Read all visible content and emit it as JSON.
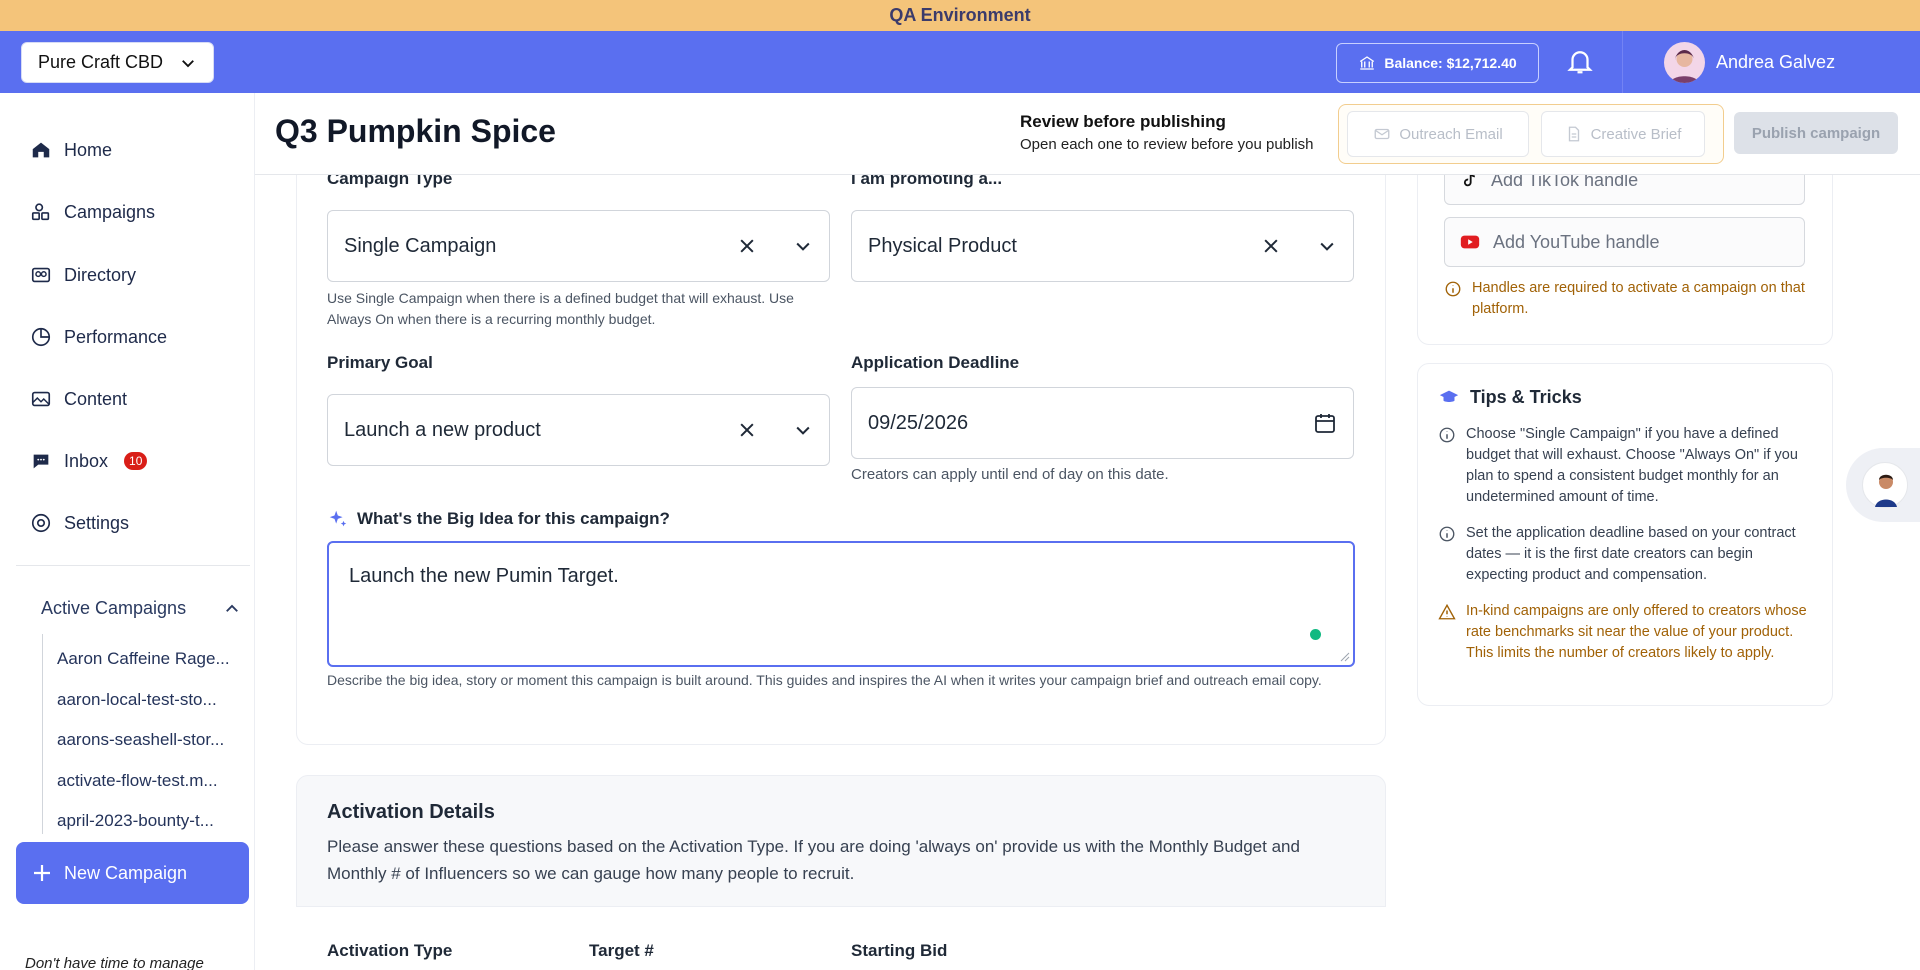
{
  "env_banner": "QA Environment",
  "topbar": {
    "org_select": "Pure Craft CBD",
    "balance": "Balance: $12,712.40",
    "user_name": "Andrea Galvez"
  },
  "sidebar": {
    "items": [
      {
        "label": "Home",
        "icon": "home-icon"
      },
      {
        "label": "Campaigns",
        "icon": "campaigns-icon"
      },
      {
        "label": "Directory",
        "icon": "directory-icon"
      },
      {
        "label": "Performance",
        "icon": "performance-icon"
      },
      {
        "label": "Content",
        "icon": "content-icon"
      },
      {
        "label": "Inbox",
        "icon": "inbox-icon",
        "badge": "10"
      },
      {
        "label": "Settings",
        "icon": "settings-icon"
      }
    ],
    "active_campaigns_label": "Active Campaigns",
    "campaigns": [
      "Aaron Caffeine Rage...",
      "aaron-local-test-sto...",
      "aarons-seashell-stor...",
      "activate-flow-test.m...",
      "april-2023-bounty-t..."
    ],
    "new_campaign": "New Campaign",
    "footer_text": "Don't have time to manage"
  },
  "header": {
    "title": "Q3 Pumpkin Spice",
    "review_title": "Review before publishing",
    "review_subtitle": "Open each one to review before you publish",
    "outreach_email": "Outreach Email",
    "creative_brief": "Creative Brief",
    "publish": "Publish campaign"
  },
  "form": {
    "campaign_type_label": "Campaign Type",
    "campaign_type_value": "Single Campaign",
    "campaign_type_help": "Use Single Campaign when there is a defined budget that will exhaust. Use Always On when there is a recurring monthly budget.",
    "promoting_label": "I am promoting a...",
    "promoting_value": "Physical Product",
    "primary_goal_label": "Primary Goal",
    "primary_goal_value": "Launch a new product",
    "deadline_label": "Application Deadline",
    "deadline_value": "09/25/2026",
    "deadline_help": "Creators can apply until end of day on this date.",
    "big_idea_label": "What's the Big Idea for this campaign?",
    "big_idea_value": "Launch the new Pumin Target.",
    "big_idea_help": "Describe the big idea, story or moment this campaign is built around. This guides and inspires the AI when it writes your campaign brief and outreach email copy."
  },
  "activation": {
    "title": "Activation Details",
    "description": "Please answer these questions based on the Activation Type. If you are doing 'always on' provide us with the Monthly Budget and Monthly # of Influencers so we can gauge how many people to recruit.",
    "col_type": "Activation Type",
    "col_target": "Target #",
    "col_bid": "Starting Bid"
  },
  "handles": {
    "tiktok_placeholder": "Add TikTok handle",
    "youtube_placeholder": "Add YouTube handle",
    "notice": "Handles are required to activate a campaign on that platform."
  },
  "tips": {
    "title": "Tips & Tricks",
    "items": [
      "Choose \"Single Campaign\" if you have a defined budget that will exhaust. Choose \"Always On\" if you plan to spend a consistent budget monthly for an undetermined amount of time.",
      "Set the application deadline based on your contract dates — it is the first date creators can begin expecting product and compensation.",
      "In-kind campaigns are only offered to creators whose rate benchmarks sit near the value of your product. This limits the number of creators likely to apply."
    ]
  },
  "colors": {
    "accent": "#5a6ff0",
    "banner": "#f4c47a",
    "warning": "#a16207",
    "badge": "#d91e18"
  }
}
